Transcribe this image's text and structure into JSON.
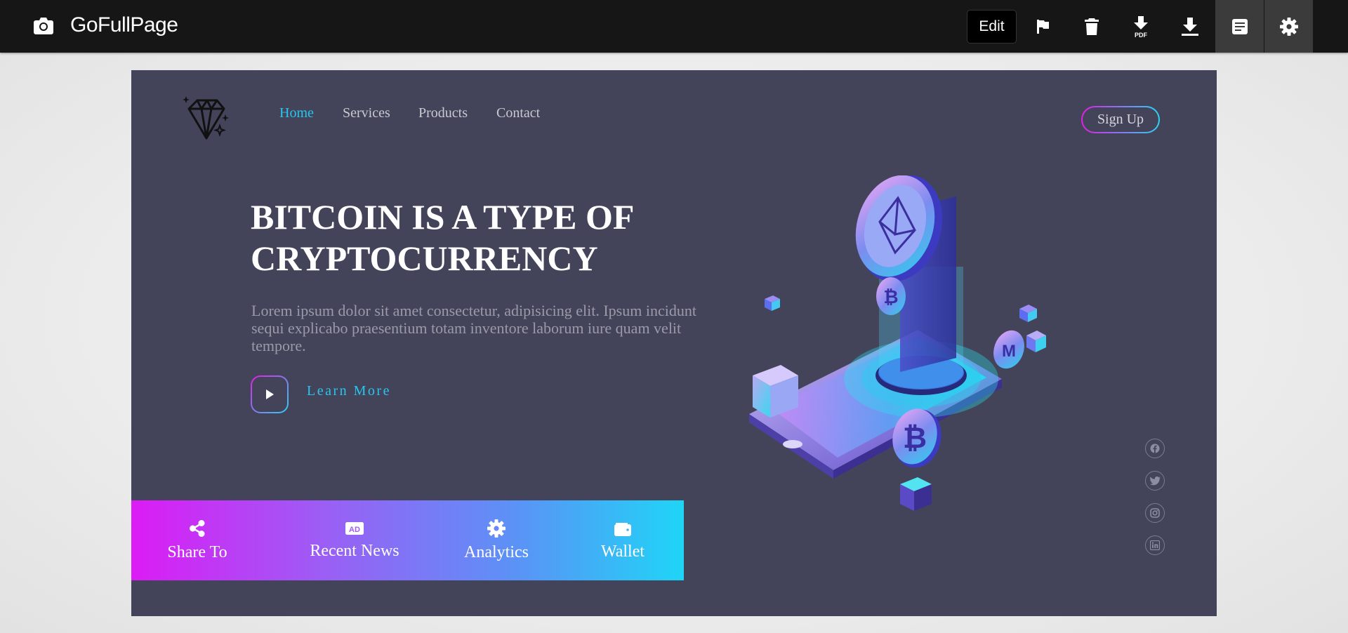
{
  "toolbar": {
    "app_name": "GoFullPage",
    "edit_label": "Edit",
    "pdf_label": "PDF",
    "icons": [
      "camera-icon",
      "flag-icon",
      "trash-icon",
      "download-pdf-icon",
      "download-icon",
      "document-icon",
      "gear-icon"
    ]
  },
  "site": {
    "nav": [
      "Home",
      "Services",
      "Products",
      "Contact"
    ],
    "signup_label": "Sign Up",
    "headline": "BITCOIN IS A TYPE OF CRYPTOCURRENCY",
    "description": "Lorem ipsum dolor sit amet consectetur, adipisicing elit. Ipsum incidunt sequi explicabo praesentium totam inventore laborum iure quam velit tempore.",
    "learn_more": "Learn More",
    "features": [
      {
        "label": "Share To",
        "icon": "share-icon"
      },
      {
        "label": "Recent News",
        "icon": "ad-icon"
      },
      {
        "label": "Analytics",
        "icon": "gear-icon"
      },
      {
        "label": "Wallet",
        "icon": "wallet-icon"
      }
    ],
    "social_icons": [
      "facebook-icon",
      "twitter-icon",
      "instagram-icon",
      "linkedin-icon"
    ],
    "colors": {
      "background": "#43445a",
      "accent": "#27c6ee",
      "gradient_start": "#dc1bf5",
      "gradient_end": "#1fd5f6"
    }
  }
}
